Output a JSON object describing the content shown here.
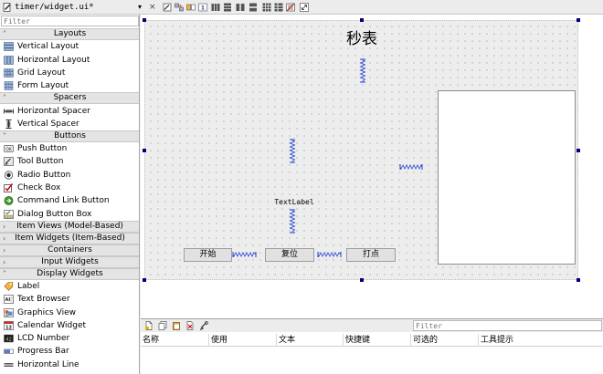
{
  "tab": {
    "title": "timer/widget.ui*",
    "dropdown_glyph": "▾",
    "close_glyph": "×"
  },
  "toolbar_icons": [
    "edit-widgets-icon",
    "edit-signals-icon",
    "edit-buddies-icon",
    "edit-tab-order-icon",
    "layout-horizontal-icon",
    "layout-vertical-icon",
    "split-horizontal-icon",
    "split-vertical-icon",
    "layout-grid-icon",
    "layout-form-icon",
    "break-layout-icon",
    "adjust-size-icon"
  ],
  "widget_box": {
    "filter_placeholder": "Filter",
    "sections": [
      {
        "name": "Layouts",
        "items": [
          {
            "label": "Vertical Layout",
            "icon": "vertical-layout-icon"
          },
          {
            "label": "Horizontal Layout",
            "icon": "horizontal-layout-icon"
          },
          {
            "label": "Grid Layout",
            "icon": "grid-layout-icon"
          },
          {
            "label": "Form Layout",
            "icon": "form-layout-icon"
          }
        ]
      },
      {
        "name": "Spacers",
        "items": [
          {
            "label": "Horizontal Spacer",
            "icon": "horizontal-spacer-icon"
          },
          {
            "label": "Vertical Spacer",
            "icon": "vertical-spacer-icon"
          }
        ]
      },
      {
        "name": "Buttons",
        "items": [
          {
            "label": "Push Button",
            "icon": "push-button-icon"
          },
          {
            "label": "Tool Button",
            "icon": "tool-button-icon"
          },
          {
            "label": "Radio Button",
            "icon": "radio-button-icon"
          },
          {
            "label": "Check Box",
            "icon": "check-box-icon"
          },
          {
            "label": "Command Link Button",
            "icon": "command-link-icon"
          },
          {
            "label": "Dialog Button Box",
            "icon": "dialog-button-box-icon"
          }
        ]
      },
      {
        "name": "Item Views (Model-Based)",
        "collapsed": true
      },
      {
        "name": "Item Widgets (Item-Based)",
        "collapsed": true
      },
      {
        "name": "Containers",
        "collapsed": true
      },
      {
        "name": "Input Widgets",
        "collapsed": true
      },
      {
        "name": "Display Widgets",
        "items": [
          {
            "label": "Label",
            "icon": "label-icon"
          },
          {
            "label": "Text Browser",
            "icon": "text-browser-icon"
          },
          {
            "label": "Graphics View",
            "icon": "graphics-view-icon"
          },
          {
            "label": "Calendar Widget",
            "icon": "calendar-icon"
          },
          {
            "label": "LCD Number",
            "icon": "lcd-number-icon"
          },
          {
            "label": "Progress Bar",
            "icon": "progress-bar-icon"
          },
          {
            "label": "Horizontal Line",
            "icon": "horizontal-line-icon"
          }
        ]
      }
    ]
  },
  "form": {
    "title": "秒表",
    "text_label": "TextLabel",
    "buttons": {
      "start": "开始",
      "reset": "复位",
      "lap": "打点"
    }
  },
  "properties_panel": {
    "filter_placeholder": "Filter",
    "columns": [
      "名称",
      "使用",
      "文本",
      "快捷键",
      "可选的",
      "工具提示"
    ]
  },
  "colors": {
    "selection_handle": "#000080",
    "spacer": "#1f3fd6",
    "form_bg": "#ededed"
  }
}
